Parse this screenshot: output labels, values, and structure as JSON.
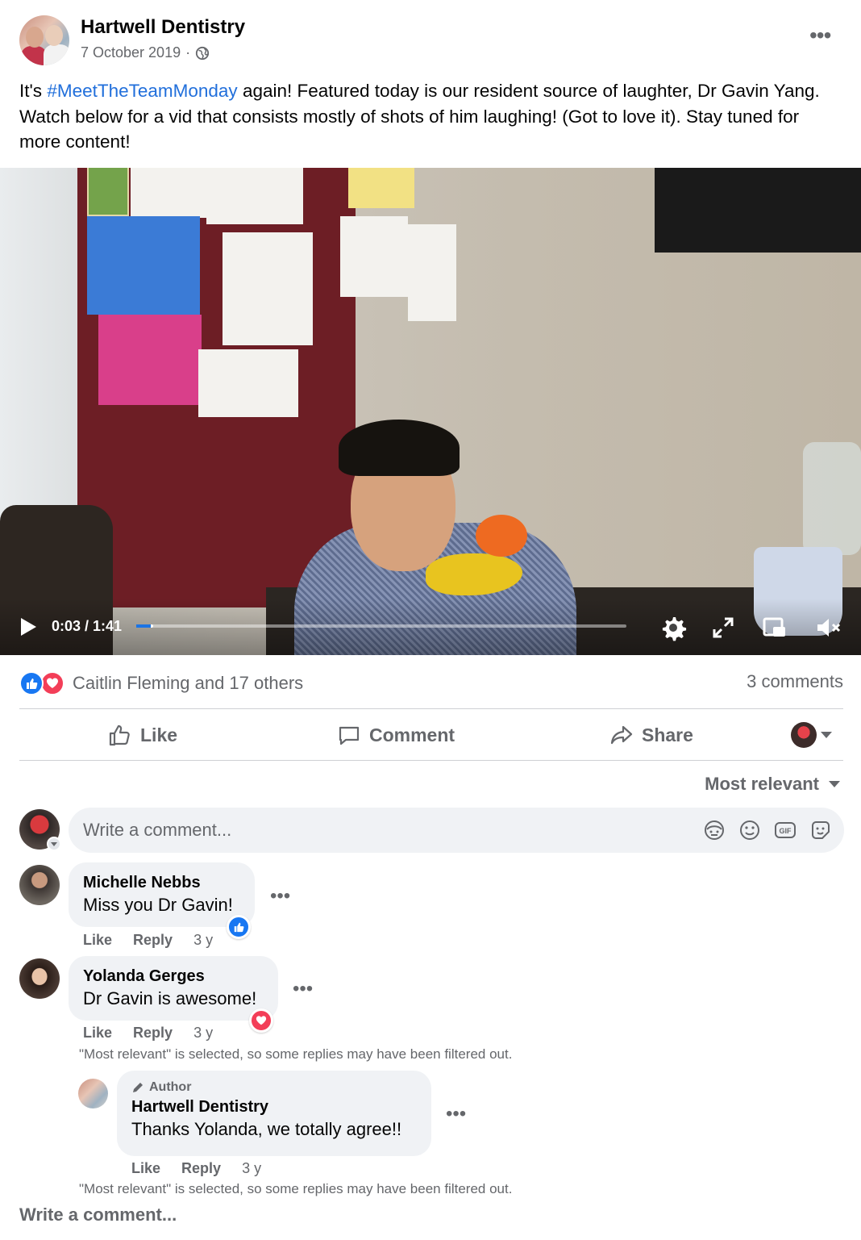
{
  "post": {
    "page_name": "Hartwell Dentistry",
    "date": "7 October 2019",
    "date_separator": "·",
    "text_before": "It's ",
    "hashtag": "#MeetTheTeamMonday",
    "text_after": " again! Featured today is our resident source of laughter, Dr Gavin Yang. Watch below for a vid that consists mostly of shots of him laughing! (Got to love it). Stay tuned for more content!",
    "more_glyph": "•••"
  },
  "video": {
    "time": "0:03 / 1:41",
    "progress": 0.035
  },
  "reactions": {
    "names": "Caitlin Fleming and 17 others",
    "comments": "3 comments"
  },
  "actions": {
    "like": "Like",
    "comment": "Comment",
    "share": "Share"
  },
  "sort": {
    "label": "Most relevant"
  },
  "composer": {
    "placeholder": "Write a comment..."
  },
  "comments": [
    {
      "name": "Michelle Nebbs",
      "text": "Miss you Dr Gavin!",
      "like": "Like",
      "reply": "Reply",
      "age": "3 y",
      "reaction": "like"
    },
    {
      "name": "Yolanda Gerges",
      "text": "Dr Gavin is awesome!",
      "like": "Like",
      "reply": "Reply",
      "age": "3 y",
      "reaction": "love"
    }
  ],
  "reply": {
    "badge": "Author",
    "name": "Hartwell Dentistry",
    "text": "Thanks Yolanda, we totally agree!!",
    "like": "Like",
    "reply": "Reply",
    "age": "3 y"
  },
  "filter_note": "\"Most relevant\" is selected, so some replies may have been filtered out.",
  "write_comment": "Write a comment...",
  "colors": {
    "accent": "#1877f2",
    "love": "#f33e58",
    "hashtag": "#216fdb",
    "muted": "#65676b"
  }
}
